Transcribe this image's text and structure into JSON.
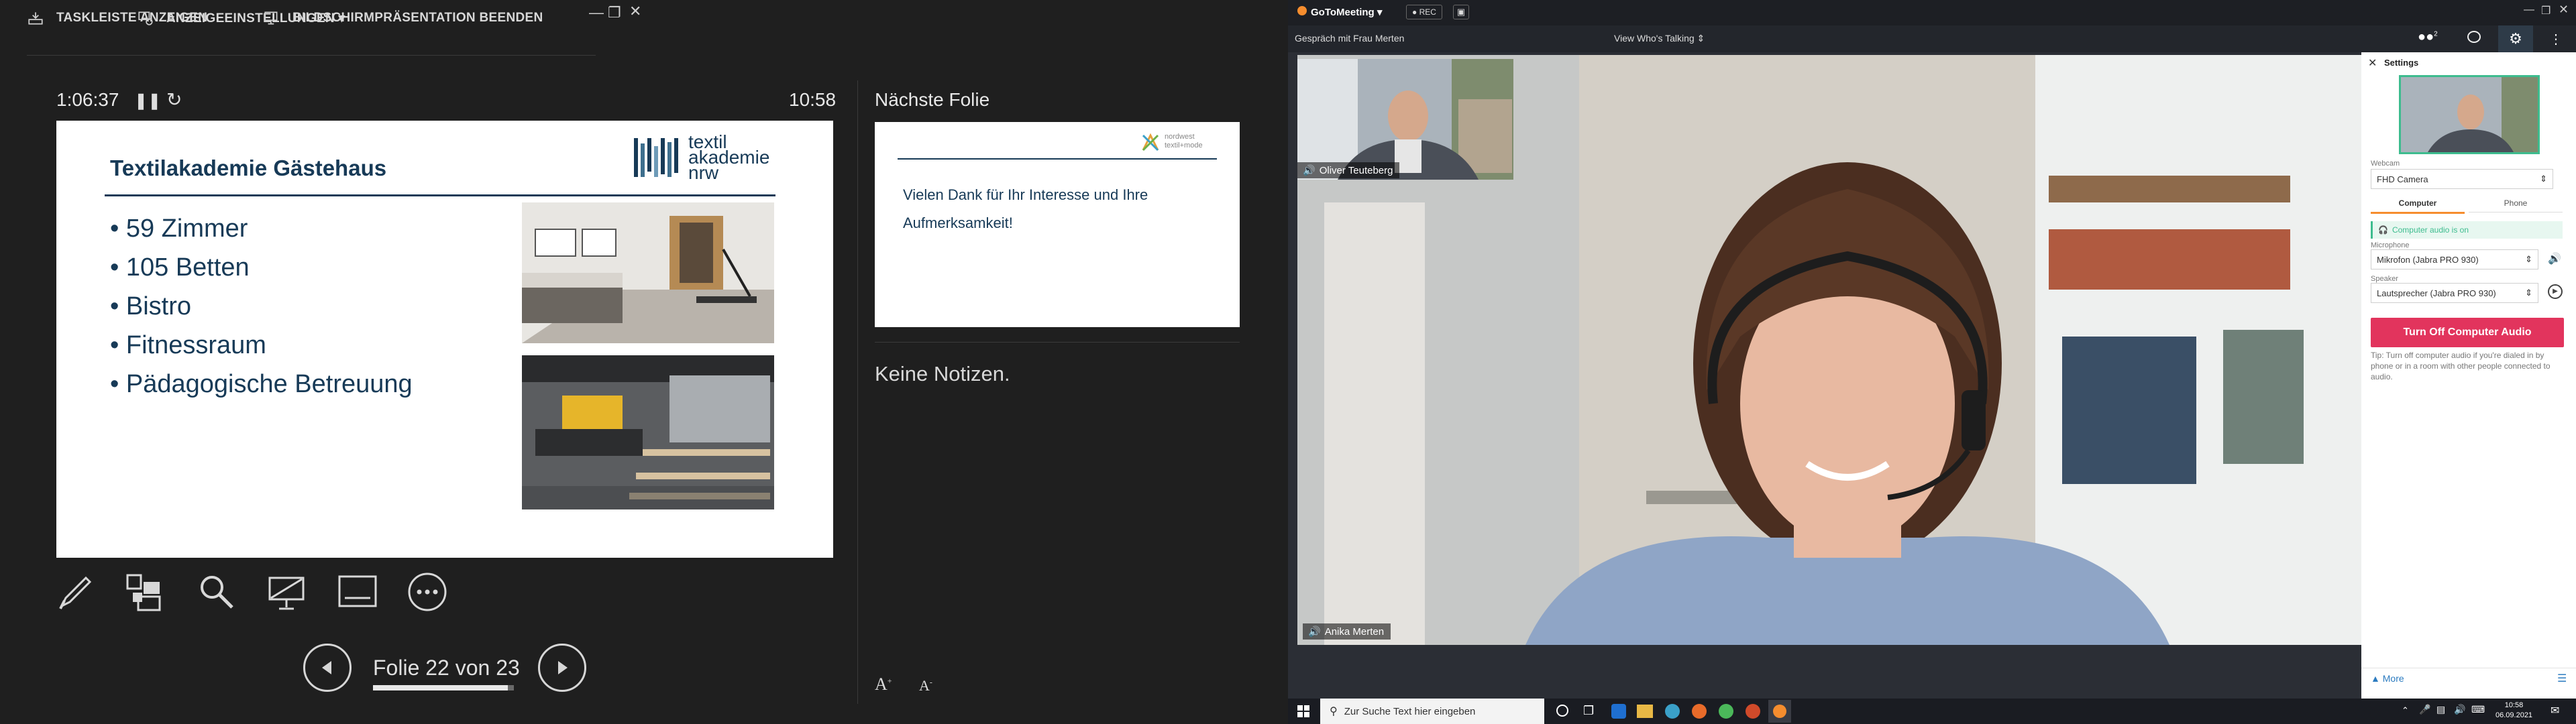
{
  "presenter": {
    "toolbar": {
      "taskbar_label": "TASKLEISTE ANZEIGEN",
      "display_settings_label": "ANZEIGEEINSTELLUNGEN ▾",
      "end_slideshow_label": "BILDSCHIRMPRÄSENTATION BEENDEN"
    },
    "timer": "1:06:37",
    "clock": "10:58",
    "current_slide": {
      "title": "Textilakademie Gästehaus",
      "logo_line1": "textil",
      "logo_line2": "akademie",
      "logo_line3": "nrw",
      "bullets": [
        "• 59 Zimmer",
        "• 105 Betten",
        "• Bistro",
        "• Fitnessraum",
        "• Pädagogische Betreuung"
      ]
    },
    "next_slide": {
      "label": "Nächste Folie",
      "logo_line1": "nordwest",
      "logo_line2": "textil+mode",
      "text": "Vielen Dank für Ihr Interesse und Ihre Aufmerksamkeit!"
    },
    "notes": "Keine Notizen.",
    "slide_counter": "Folie 22 von 23",
    "progress_fraction": 0.957,
    "font_increase": "A",
    "font_decrease": "A"
  },
  "gtm": {
    "app_title": "GoToMeeting ▾",
    "rec_label": "● REC",
    "conversation": "Gespräch mit Frau Merten",
    "view_mode": "View Who's Talking",
    "participants_count": "2",
    "thumb_name": "Oliver Teuteberg",
    "main_name": "Anika Merten",
    "settings": {
      "title": "Settings",
      "webcam_label": "Webcam",
      "webcam_value": "FHD Camera",
      "tab_computer": "Computer",
      "tab_phone": "Phone",
      "audio_status": "Computer audio is on",
      "mic_label": "Microphone",
      "mic_value": "Mikrofon (Jabra PRO 930)",
      "speaker_label": "Speaker",
      "speaker_value": "Lautsprecher (Jabra PRO 930)",
      "turn_off_label": "Turn Off Computer Audio",
      "tip": "Tip: Turn off computer audio if you're dialed in by phone or in a room with other people connected to audio.",
      "more_label": "More"
    }
  },
  "taskbar": {
    "search_placeholder": "Zur Suche Text hier eingeben",
    "time": "10:58",
    "date": "06.09.2021"
  },
  "colors": {
    "slide_blue": "#173a57",
    "gtm_orange": "#f68d2e",
    "gtm_red": "#e2345d",
    "audio_green": "#3dbc8e"
  }
}
